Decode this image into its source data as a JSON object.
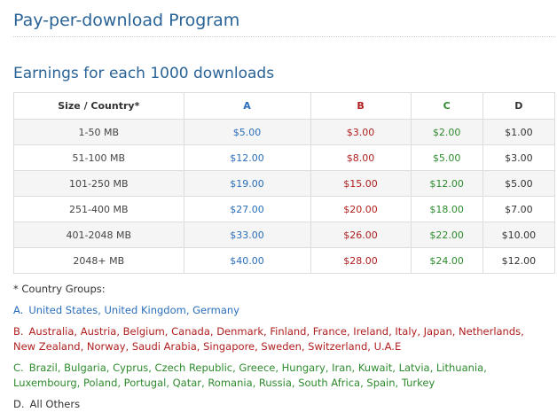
{
  "page_title": "Pay-per-download Program",
  "section_title": "Earnings for each 1000 downloads",
  "table": {
    "headers": [
      "Size / Country*",
      "A",
      "B",
      "C",
      "D"
    ],
    "rows": [
      [
        "1-50 MB",
        "$5.00",
        "$3.00",
        "$2.00",
        "$1.00"
      ],
      [
        "51-100 MB",
        "$12.00",
        "$8.00",
        "$5.00",
        "$3.00"
      ],
      [
        "101-250 MB",
        "$19.00",
        "$15.00",
        "$12.00",
        "$5.00"
      ],
      [
        "251-400 MB",
        "$27.00",
        "$20.00",
        "$18.00",
        "$7.00"
      ],
      [
        "401-2048 MB",
        "$33.00",
        "$26.00",
        "$22.00",
        "$10.00"
      ],
      [
        "2048+ MB",
        "$40.00",
        "$28.00",
        "$24.00",
        "$12.00"
      ]
    ]
  },
  "groups": {
    "note": "* Country Groups:",
    "a": {
      "letter": "A.",
      "countries": "United States, United Kingdom, Germany"
    },
    "b": {
      "letter": "B.",
      "countries": "Australia, Austria, Belgium, Canada, Denmark, Finland, France, Ireland, Italy, Japan, Netherlands, New Zealand, Norway, Saudi Arabia, Singapore, Sweden, Switzerland, U.A.E"
    },
    "c": {
      "letter": "C.",
      "countries": "Brazil, Bulgaria, Cyprus, Czech Republic, Greece, Hungary, Iran, Kuwait, Latvia, Lithuania, Luxembourg, Poland, Portugal, Qatar, Romania, Russia, South Africa, Spain, Turkey"
    },
    "d": {
      "letter": "D.",
      "countries": "All Others"
    }
  },
  "colors": {
    "title": "#2a6396",
    "group_a": "#2a6ebb",
    "group_b": "#b01e1e",
    "group_c": "#2e8b2e",
    "group_d": "#333333"
  }
}
